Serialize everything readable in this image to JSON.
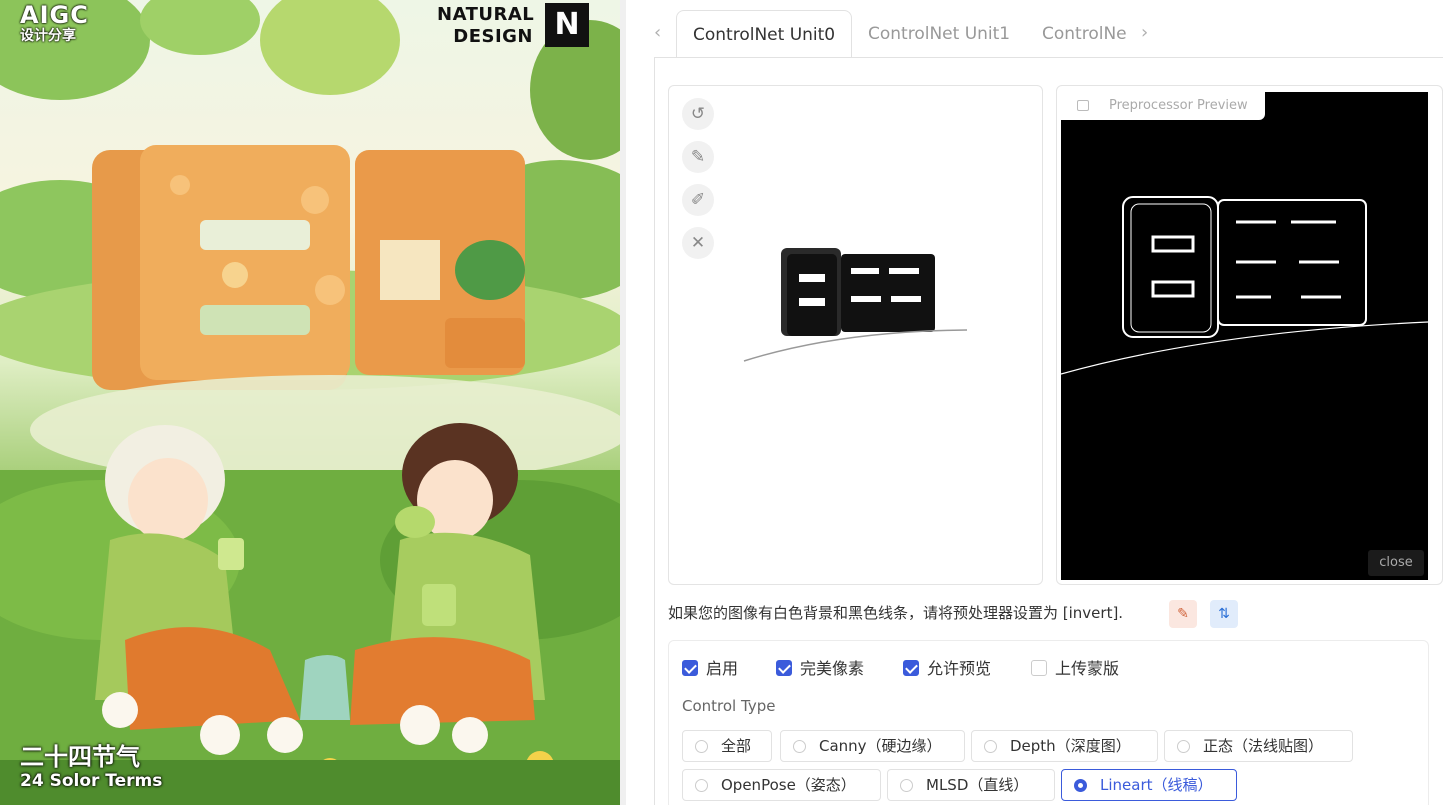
{
  "poster": {
    "brand_top": "AIGC",
    "brand_sub": "设计分享",
    "natural_line1": "NATURAL",
    "natural_line2": "DESIGN",
    "footer_cn": "二十四节气",
    "footer_en": "24 Solor Terms"
  },
  "tabs": [
    {
      "label": "ControlNet Unit0",
      "active": true
    },
    {
      "label": "ControlNet Unit1",
      "active": false
    },
    {
      "label": "ControlNe",
      "active": false
    }
  ],
  "canvas_tools": [
    "undo-icon",
    "eraser-icon",
    "brush-icon",
    "clear-icon"
  ],
  "preview": {
    "label": "Preprocessor Preview",
    "close": "close"
  },
  "hint_text": "如果您的图像有白色背景和黑色线条，请将预处理器设置为 [invert].",
  "checkboxes": [
    {
      "label": "启用",
      "checked": true
    },
    {
      "label": "完美像素",
      "checked": true
    },
    {
      "label": "允许预览",
      "checked": true
    },
    {
      "label": "上传蒙版",
      "checked": false
    }
  ],
  "control_type_label": "Control Type",
  "control_types": [
    {
      "label": "全部",
      "selected": false
    },
    {
      "label": "Canny（硬边缘）",
      "selected": false
    },
    {
      "label": "Depth（深度图）",
      "selected": false
    },
    {
      "label": "正态（法线贴图）",
      "selected": false
    },
    {
      "label": "OpenPose（姿态）",
      "selected": false
    },
    {
      "label": "MLSD（直线）",
      "selected": false
    },
    {
      "label": "Lineart（线稿）",
      "selected": true
    }
  ],
  "colors": {
    "accent": "#3b5bdb"
  }
}
